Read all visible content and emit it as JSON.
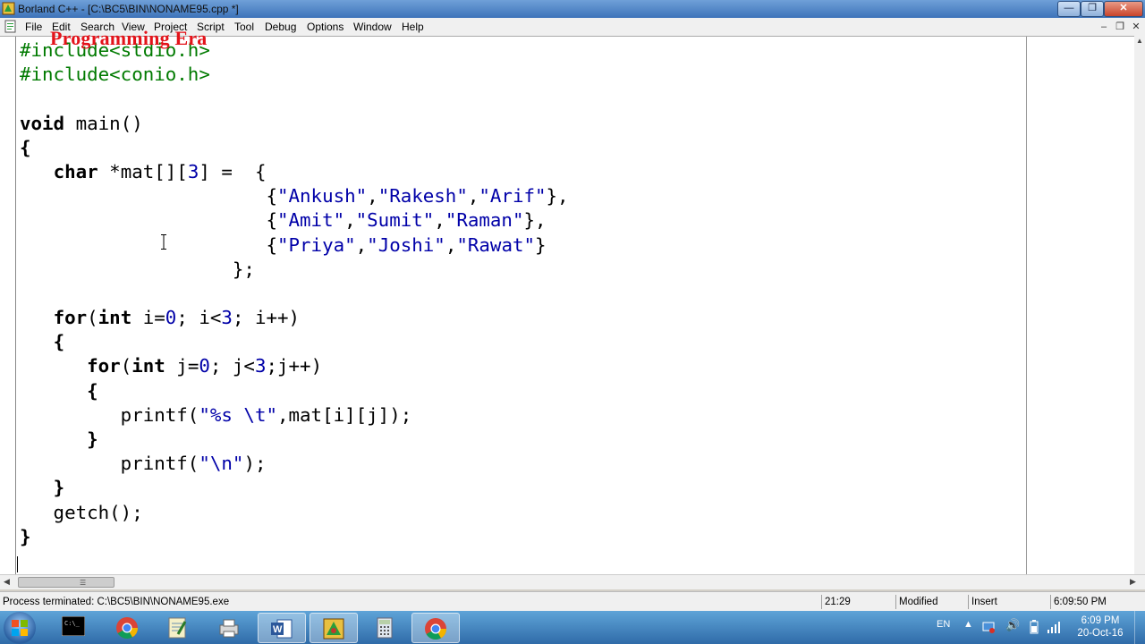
{
  "window": {
    "title": "Borland C++ - [C:\\BC5\\BIN\\NONAME95.cpp *]"
  },
  "menu": [
    "File",
    "Edit",
    "Search",
    "View",
    "Project",
    "Script",
    "Tool",
    "Debug",
    "Options",
    "Window",
    "Help"
  ],
  "watermark": "Programming Era",
  "code_lines": [
    [
      [
        "pp",
        "#include<stdio.h>"
      ]
    ],
    [
      [
        "pp",
        "#include<conio.h>"
      ]
    ],
    [],
    [
      [
        "kw",
        "void"
      ],
      [
        "tx",
        " main()"
      ]
    ],
    [
      [
        "kw",
        "{"
      ]
    ],
    [
      [
        "tx",
        "   "
      ],
      [
        "kw",
        "char"
      ],
      [
        "tx",
        " *mat[]["
      ],
      [
        "num",
        "3"
      ],
      [
        "tx",
        "] =  {"
      ]
    ],
    [
      [
        "tx",
        "                      {"
      ],
      [
        "str",
        "\"Ankush\""
      ],
      [
        "tx",
        ","
      ],
      [
        "str",
        "\"Rakesh\""
      ],
      [
        "tx",
        ","
      ],
      [
        "str",
        "\"Arif\""
      ],
      [
        "tx",
        "},"
      ]
    ],
    [
      [
        "tx",
        "                      {"
      ],
      [
        "str",
        "\"Amit\""
      ],
      [
        "tx",
        ","
      ],
      [
        "str",
        "\"Sumit\""
      ],
      [
        "tx",
        ","
      ],
      [
        "str",
        "\"Raman\""
      ],
      [
        "tx",
        "},"
      ]
    ],
    [
      [
        "tx",
        "                      {"
      ],
      [
        "str",
        "\"Priya\""
      ],
      [
        "tx",
        ","
      ],
      [
        "str",
        "\"Joshi\""
      ],
      [
        "tx",
        ","
      ],
      [
        "str",
        "\"Rawat\""
      ],
      [
        "tx",
        "}"
      ]
    ],
    [
      [
        "tx",
        "                   };"
      ]
    ],
    [],
    [
      [
        "tx",
        "   "
      ],
      [
        "kw",
        "for"
      ],
      [
        "tx",
        "("
      ],
      [
        "kw",
        "int"
      ],
      [
        "tx",
        " i="
      ],
      [
        "num",
        "0"
      ],
      [
        "tx",
        "; i<"
      ],
      [
        "num",
        "3"
      ],
      [
        "tx",
        "; i++)"
      ]
    ],
    [
      [
        "tx",
        "   "
      ],
      [
        "kw",
        "{"
      ]
    ],
    [
      [
        "tx",
        "      "
      ],
      [
        "kw",
        "for"
      ],
      [
        "tx",
        "("
      ],
      [
        "kw",
        "int"
      ],
      [
        "tx",
        " j="
      ],
      [
        "num",
        "0"
      ],
      [
        "tx",
        "; j<"
      ],
      [
        "num",
        "3"
      ],
      [
        "tx",
        ";j++)"
      ]
    ],
    [
      [
        "tx",
        "      "
      ],
      [
        "kw",
        "{"
      ]
    ],
    [
      [
        "tx",
        "         printf("
      ],
      [
        "str",
        "\"%s \\t\""
      ],
      [
        "tx",
        ",mat[i][j]);"
      ]
    ],
    [
      [
        "tx",
        "      "
      ],
      [
        "kw",
        "}"
      ]
    ],
    [
      [
        "tx",
        "         printf("
      ],
      [
        "str",
        "\"\\n\""
      ],
      [
        "tx",
        ");"
      ]
    ],
    [
      [
        "tx",
        "   "
      ],
      [
        "kw",
        "}"
      ]
    ],
    [
      [
        "tx",
        "   getch();"
      ]
    ],
    [
      [
        "kw",
        "}"
      ]
    ]
  ],
  "status": {
    "message": "Process terminated: C:\\BC5\\BIN\\NONAME95.exe",
    "position": "21:29",
    "modified": "Modified",
    "mode": "Insert",
    "time": "6:09:50 PM"
  },
  "taskbar": {
    "language": "EN",
    "clock_time": "6:09 PM",
    "clock_date": "20-Oct-16"
  },
  "colors": {
    "keyword": "#000000",
    "preprocessor": "#007a00",
    "string": "#0000a8",
    "watermark": "#e3131a"
  }
}
